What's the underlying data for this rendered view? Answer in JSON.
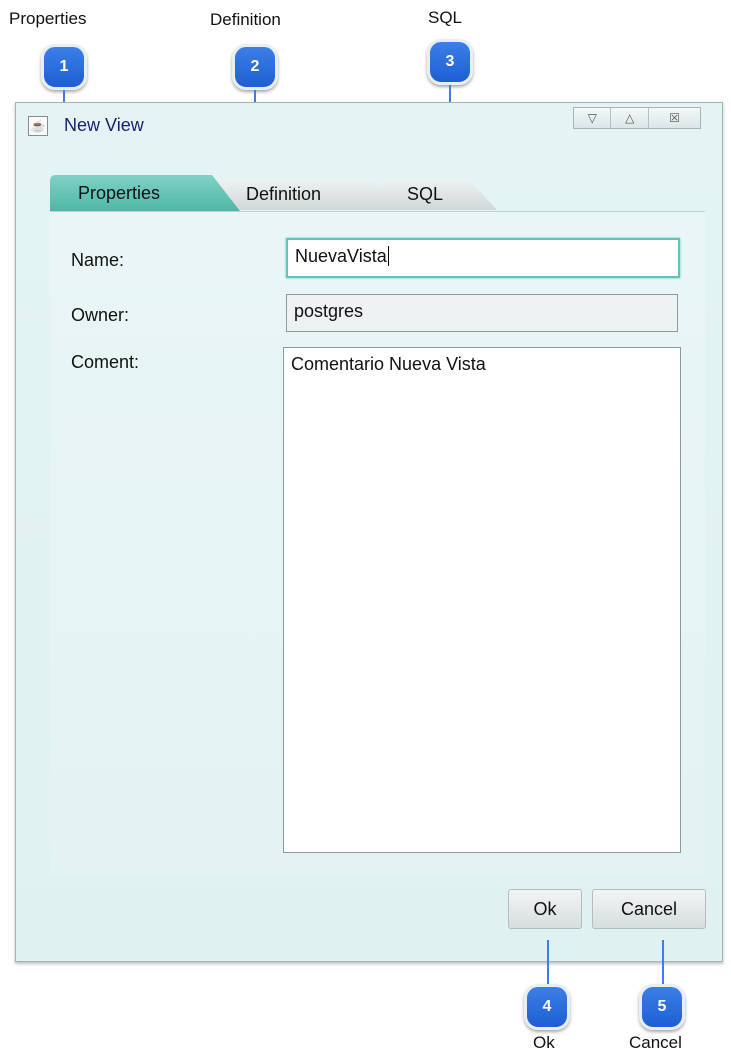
{
  "annotations": {
    "top": [
      {
        "number": "1",
        "label": "Properties"
      },
      {
        "number": "2",
        "label": "Definition"
      },
      {
        "number": "3",
        "label": "SQL"
      }
    ],
    "bottom": [
      {
        "number": "4",
        "label": "Ok"
      },
      {
        "number": "5",
        "label": "Cancel"
      }
    ]
  },
  "window": {
    "title": "New View",
    "controls": [
      "▽",
      "△",
      "☒"
    ]
  },
  "tabs": [
    {
      "label": "Properties",
      "active": true
    },
    {
      "label": "Definition",
      "active": false
    },
    {
      "label": "SQL",
      "active": false
    }
  ],
  "form": {
    "name_label": "Name:",
    "name_value": "NuevaVista",
    "owner_label": "Owner:",
    "owner_value": "postgres",
    "comment_label": "Coment:",
    "comment_value": "Comentario Nueva Vista"
  },
  "buttons": {
    "ok": "Ok",
    "cancel": "Cancel"
  },
  "colors": {
    "accent": "#5cc6b8",
    "annotation_badge": "#1d5fd3",
    "title_text": "#1a1f6b"
  }
}
